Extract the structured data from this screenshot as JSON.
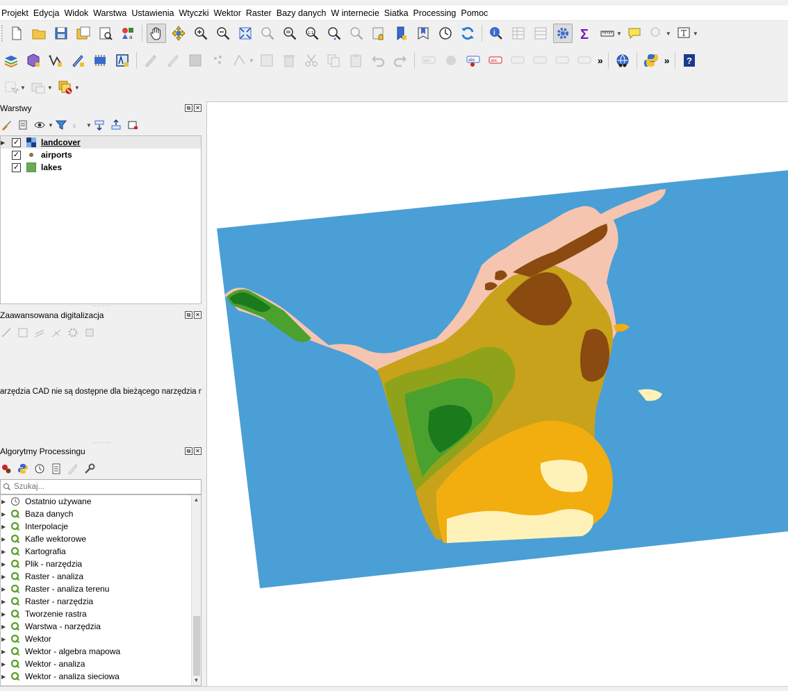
{
  "menubar": {
    "items": [
      "Projekt",
      "Edycja",
      "Widok",
      "Warstwa",
      "Ustawienia",
      "Wtyczki",
      "Wektor",
      "Raster",
      "Bazy danych",
      "W internecie",
      "Siatka",
      "Processing",
      "Pomoc"
    ]
  },
  "layers_panel": {
    "title": "Warstwy",
    "layers": [
      {
        "name": "landcover",
        "checked": true,
        "selected": true,
        "icon": "raster-icon"
      },
      {
        "name": "airports",
        "checked": true,
        "selected": false,
        "icon": "point-icon"
      },
      {
        "name": "lakes",
        "checked": true,
        "selected": false,
        "icon": "polygon-icon"
      }
    ]
  },
  "digitizing_panel": {
    "title": "Zaawansowana digitalizacja",
    "message": "arzędzia CAD nie są dostępne dla bieżącego narzędzia mapy"
  },
  "processing_panel": {
    "title": "Algorytmy Processingu",
    "search_placeholder": "Szukaj...",
    "items": [
      {
        "label": "Ostatnio używane",
        "icon": "clock-icon"
      },
      {
        "label": "Baza danych",
        "icon": "qgis-icon"
      },
      {
        "label": "Interpolacje",
        "icon": "qgis-icon"
      },
      {
        "label": "Kafle wektorowe",
        "icon": "qgis-icon"
      },
      {
        "label": "Kartografia",
        "icon": "qgis-icon"
      },
      {
        "label": "Plik - narzędzia",
        "icon": "qgis-icon"
      },
      {
        "label": "Raster - analiza",
        "icon": "qgis-icon"
      },
      {
        "label": "Raster - analiza terenu",
        "icon": "qgis-icon"
      },
      {
        "label": "Raster - narzędzia",
        "icon": "qgis-icon"
      },
      {
        "label": "Tworzenie rastra",
        "icon": "qgis-icon"
      },
      {
        "label": "Warstwa - narzędzia",
        "icon": "qgis-icon"
      },
      {
        "label": "Wektor",
        "icon": "qgis-icon"
      },
      {
        "label": "Wektor - algebra mapowa",
        "icon": "qgis-icon"
      },
      {
        "label": "Wektor - analiza",
        "icon": "qgis-icon"
      },
      {
        "label": "Wektor - analiza sieciowa",
        "icon": "qgis-icon"
      }
    ]
  },
  "toolbar": {
    "overflow_glyph": "»"
  },
  "colors": {
    "water": "#4a9fd6",
    "tundra": "#f5c5b0",
    "forest_dark": "#1b7a1b",
    "forest": "#4aa12e",
    "shrub": "#8fa31a",
    "grass": "#c8a21a",
    "barren": "#fff2b8",
    "desert": "#f2ad0f",
    "bare_brown": "#8a4a10",
    "qgis_green": "#5aa02c"
  }
}
